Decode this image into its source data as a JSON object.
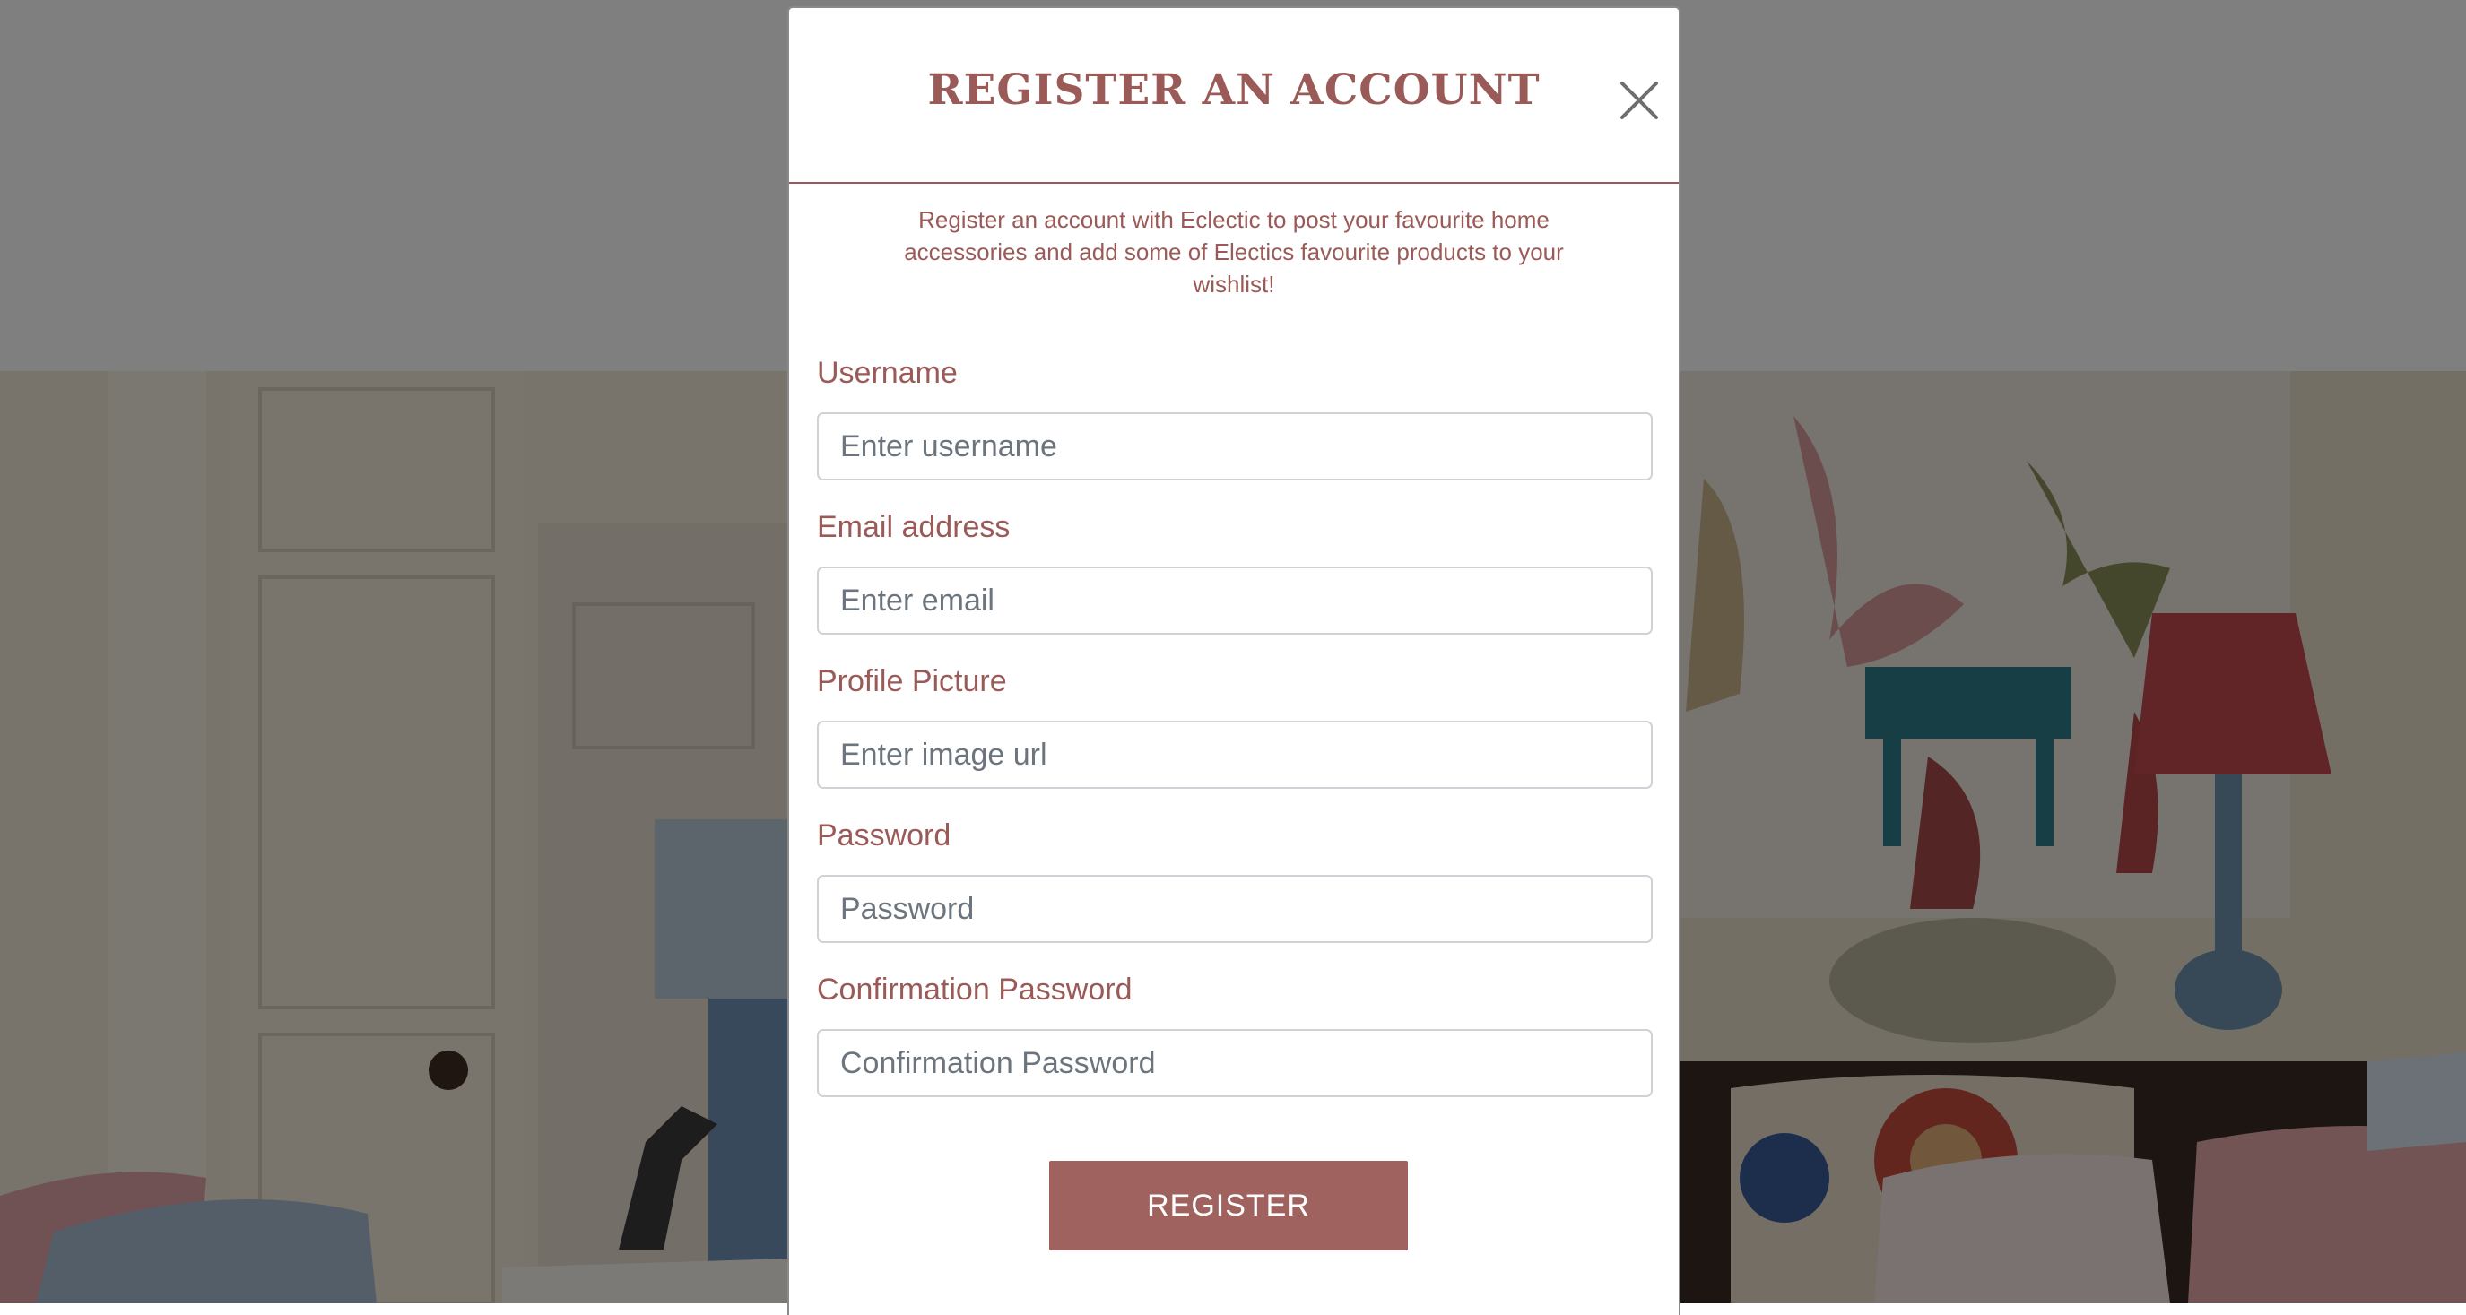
{
  "modal": {
    "title": "REGISTER AN ACCOUNT",
    "description": "Register an account with Eclectic to post your favourite home accessories and add some of Electics favourite products to your wishlist!",
    "fields": [
      {
        "label": "Username",
        "placeholder": "Enter username",
        "type": "text"
      },
      {
        "label": "Email address",
        "placeholder": "Enter email",
        "type": "email"
      },
      {
        "label": "Profile Picture",
        "placeholder": "Enter image url",
        "type": "text"
      },
      {
        "label": "Password",
        "placeholder": "Password",
        "type": "password"
      },
      {
        "label": "Confirmation Password",
        "placeholder": "Confirmation Password",
        "type": "password"
      }
    ],
    "submit_label": "REGISTER"
  },
  "colors": {
    "brand": "#9a5a57",
    "button": "#a0625f",
    "input_border": "#cfd3d7",
    "overlay": "rgba(0,0,0,0.5)"
  },
  "icons": {
    "close": "close-icon"
  }
}
